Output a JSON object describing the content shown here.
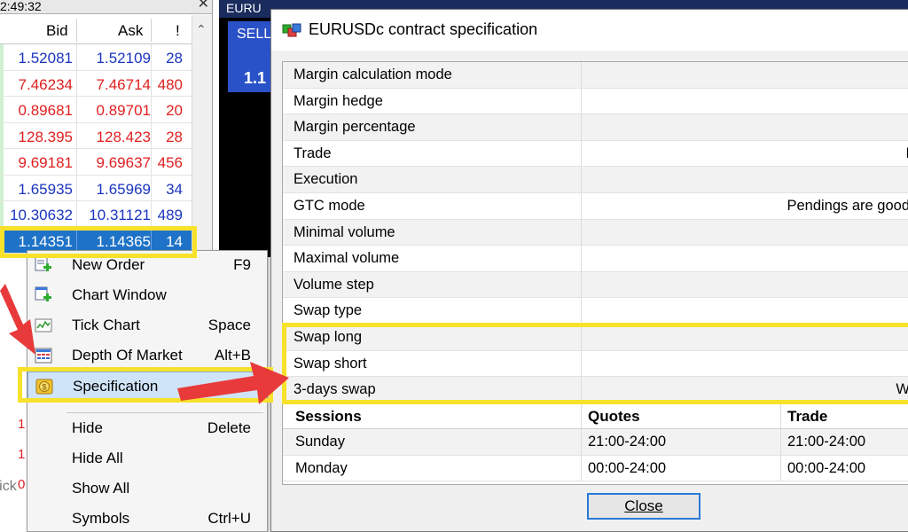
{
  "market_watch": {
    "time": "2:49:32",
    "columns": {
      "bid": "Bid",
      "ask": "Ask",
      "spread": "!"
    },
    "rows": [
      {
        "bid": "1.52081",
        "ask": "1.52109",
        "spread": "28",
        "color": "blue"
      },
      {
        "bid": "7.46234",
        "ask": "7.46714",
        "spread": "480",
        "color": "red"
      },
      {
        "bid": "0.89681",
        "ask": "0.89701",
        "spread": "20",
        "color": "red"
      },
      {
        "bid": "128.395",
        "ask": "128.423",
        "spread": "28",
        "color": "red"
      },
      {
        "bid": "9.69181",
        "ask": "9.69637",
        "spread": "456",
        "color": "red"
      },
      {
        "bid": "1.65935",
        "ask": "1.65969",
        "spread": "34",
        "color": "blue"
      },
      {
        "bid": "10.30632",
        "ask": "10.31121",
        "spread": "489",
        "color": "blue"
      },
      {
        "bid": "1.14351",
        "ask": "1.14365",
        "spread": "14",
        "color": "selected"
      }
    ],
    "tab_tick": "Tick"
  },
  "chart": {
    "title": "EURU",
    "sell_label": "SELL",
    "sell_price": "1.1"
  },
  "context_menu": {
    "items": [
      {
        "label": "New Order",
        "key": "F9",
        "icon": "new-order-icon"
      },
      {
        "label": "Chart Window",
        "key": "",
        "icon": "chart-window-icon"
      },
      {
        "label": "Tick Chart",
        "key": "Space",
        "icon": "tick-chart-icon"
      },
      {
        "label": "Depth Of Market",
        "key": "Alt+B",
        "icon": "depth-of-market-icon"
      },
      {
        "label": "Specification",
        "key": "",
        "icon": "specification-icon"
      },
      {
        "label": "Hide",
        "key": "Delete",
        "icon": ""
      },
      {
        "label": "Hide All",
        "key": "",
        "icon": ""
      },
      {
        "label": "Show All",
        "key": "",
        "icon": ""
      },
      {
        "label": "Symbols",
        "key": "Ctrl+U",
        "icon": ""
      }
    ]
  },
  "dialog": {
    "title": "EURUSDc contract specification",
    "specs": [
      {
        "label": "Margin calculation mode",
        "value": ""
      },
      {
        "label": "Margin hedge",
        "value": ""
      },
      {
        "label": "Margin percentage",
        "value": ""
      },
      {
        "label": "Trade",
        "value": "I"
      },
      {
        "label": "Execution",
        "value": ""
      },
      {
        "label": "GTC mode",
        "value": "Pendings are good"
      },
      {
        "label": "Minimal volume",
        "value": ""
      },
      {
        "label": "Maximal volume",
        "value": ""
      },
      {
        "label": "Volume step",
        "value": ""
      },
      {
        "label": "Swap type",
        "value": ""
      },
      {
        "label": "Swap long",
        "value": ""
      },
      {
        "label": "Swap short",
        "value": ""
      },
      {
        "label": "3-days swap",
        "value": "W"
      }
    ],
    "sessions_header": {
      "sessions": "Sessions",
      "quotes": "Quotes",
      "trade": "Trade"
    },
    "sessions": [
      {
        "day": "Sunday",
        "quotes": "21:00-24:00",
        "trade": "21:00-24:00"
      },
      {
        "day": "Monday",
        "quotes": "00:00-24:00",
        "trade": "00:00-24:00"
      }
    ],
    "close_label": "Close"
  },
  "colors": {
    "highlight": "#f7e12b",
    "arrow": "#e83a3a",
    "selection": "#1e73c8",
    "bid_blue": "#1a35c0",
    "bid_red": "#e02020"
  }
}
